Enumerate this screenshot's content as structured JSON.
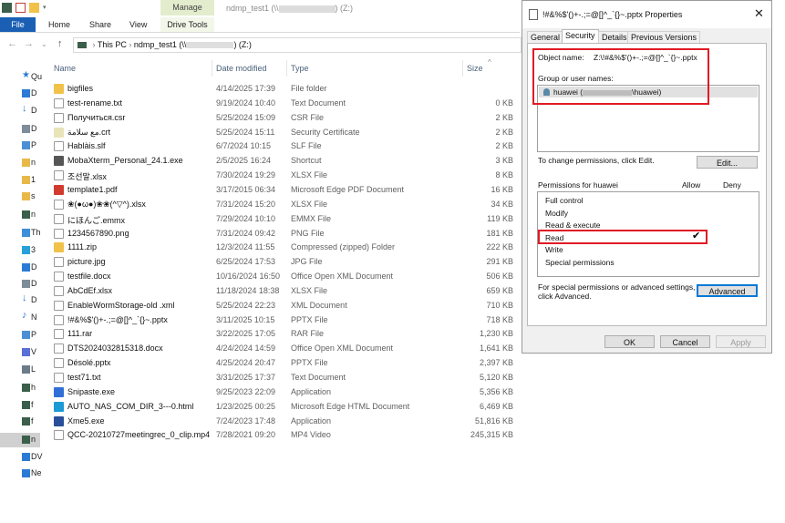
{
  "explorer": {
    "title_tab": "Manage",
    "window_title_prefix": "ndmp_test1 (\\\\",
    "window_title_suffix": ") (Z:)",
    "ribbon": {
      "file": "File",
      "home": "Home",
      "share": "Share",
      "view": "View",
      "drive_tools": "Drive Tools"
    },
    "address": {
      "this_pc": "This PC",
      "share_prefix": "ndmp_test1 (\\\\",
      "share_suffix": ") (Z:)"
    },
    "columns": {
      "name": "Name",
      "date": "Date modified",
      "type": "Type",
      "size": "Size"
    },
    "sidebar": [
      {
        "label": "Qu",
        "icon": "star-icon",
        "color": "#2b7bd6"
      },
      {
        "label": "D",
        "icon": "desktop-icon",
        "color": "#2b7bd6"
      },
      {
        "label": "D",
        "icon": "download-icon",
        "color": "#2b7bd6"
      },
      {
        "label": "D",
        "icon": "document-icon",
        "color": "#7f8c99"
      },
      {
        "label": "P",
        "icon": "pictures-icon",
        "color": "#4d8fd6"
      },
      {
        "label": "n",
        "icon": "folder-icon",
        "color": "#e8b94a"
      },
      {
        "label": "1",
        "icon": "folder-icon",
        "color": "#e8b94a"
      },
      {
        "label": "s",
        "icon": "folder-icon",
        "color": "#e8b94a"
      },
      {
        "label": "n",
        "icon": "network-drive-icon",
        "color": "#3b5f4a"
      },
      {
        "label": "Th",
        "icon": "this-pc-icon",
        "color": "#3c8fd8"
      },
      {
        "label": "3",
        "icon": "3d-objects-icon",
        "color": "#29a0d8"
      },
      {
        "label": "D",
        "icon": "desktop-icon",
        "color": "#2b7bd6"
      },
      {
        "label": "D",
        "icon": "document-icon",
        "color": "#7f8c99"
      },
      {
        "label": "D",
        "icon": "download-icon",
        "color": "#2b7bd6"
      },
      {
        "label": "N",
        "icon": "music-icon",
        "color": "#2b7bd6"
      },
      {
        "label": "P",
        "icon": "pictures-icon",
        "color": "#4d8fd6"
      },
      {
        "label": "V",
        "icon": "videos-icon",
        "color": "#5b6fd6"
      },
      {
        "label": "L",
        "icon": "local-disk-icon",
        "color": "#6b7b8a"
      },
      {
        "label": "h",
        "icon": "network-drive-icon",
        "color": "#3b5f4a"
      },
      {
        "label": "f",
        "icon": "network-drive-icon",
        "color": "#3b5f4a"
      },
      {
        "label": "f",
        "icon": "network-drive-icon",
        "color": "#3b5f4a"
      },
      {
        "label": "n",
        "icon": "network-drive-icon",
        "color": "#3b5f4a"
      },
      {
        "label": "DV",
        "icon": "dvd-drive-icon",
        "color": "#2b7bd6"
      },
      {
        "label": "Ne",
        "icon": "network-icon",
        "color": "#2b7bd6"
      }
    ],
    "files": [
      {
        "name": "bigfiles",
        "date": "4/14/2025 17:39",
        "type": "File folder",
        "size": "",
        "icon": "folder-icon",
        "color": "#f0c24a"
      },
      {
        "name": "test-rename.txt",
        "date": "9/19/2024 10:40",
        "type": "Text Document",
        "size": "0 KB",
        "icon": "text-file-icon",
        "color": "#ffffff"
      },
      {
        "name": "Получиться.csr",
        "date": "5/25/2024 15:09",
        "type": "CSR File",
        "size": "2 KB",
        "icon": "file-icon",
        "color": "#ffffff"
      },
      {
        "name": "مع سلامة.crt",
        "date": "5/25/2024 15:11",
        "type": "Security Certificate",
        "size": "2 KB",
        "icon": "certificate-icon",
        "color": "#e9e3b8"
      },
      {
        "name": "Hablàis.slf",
        "date": "6/7/2024 10:15",
        "type": "SLF File",
        "size": "2 KB",
        "icon": "file-icon",
        "color": "#ffffff"
      },
      {
        "name": "MobaXterm_Personal_24.1.exe",
        "date": "2/5/2025 16:24",
        "type": "Shortcut",
        "size": "3 KB",
        "icon": "shortcut-icon",
        "color": "#555555"
      },
      {
        "name": "조선말.xlsx",
        "date": "7/30/2024 19:29",
        "type": "XLSX File",
        "size": "8 KB",
        "icon": "file-icon",
        "color": "#ffffff"
      },
      {
        "name": "template1.pdf",
        "date": "3/17/2015 06:34",
        "type": "Microsoft Edge PDF Document",
        "size": "16 KB",
        "icon": "pdf-icon",
        "color": "#d13b2e"
      },
      {
        "name": "❀(●ω●)❀❀(^▽^).xlsx",
        "date": "7/31/2024 15:20",
        "type": "XLSX File",
        "size": "34 KB",
        "icon": "file-icon",
        "color": "#ffffff"
      },
      {
        "name": "にほんご.emmx",
        "date": "7/29/2024 10:10",
        "type": "EMMX File",
        "size": "119 KB",
        "icon": "file-icon",
        "color": "#ffffff"
      },
      {
        "name": "1234567890.png",
        "date": "7/31/2024 09:42",
        "type": "PNG File",
        "size": "181 KB",
        "icon": "file-icon",
        "color": "#ffffff"
      },
      {
        "name": "1111.zip",
        "date": "12/3/2024 11:55",
        "type": "Compressed (zipped) Folder",
        "size": "222 KB",
        "icon": "zip-folder-icon",
        "color": "#f0c24a"
      },
      {
        "name": "picture.jpg",
        "date": "6/25/2024 17:53",
        "type": "JPG File",
        "size": "291 KB",
        "icon": "file-icon",
        "color": "#ffffff"
      },
      {
        "name": "testfile.docx",
        "date": "10/16/2024 16:50",
        "type": "Office Open XML Document",
        "size": "506 KB",
        "icon": "file-icon",
        "color": "#ffffff"
      },
      {
        "name": "AbCdEf.xlsx",
        "date": "11/18/2024 18:38",
        "type": "XLSX File",
        "size": "659 KB",
        "icon": "file-icon",
        "color": "#ffffff"
      },
      {
        "name": "EnableWormStorage-old .xml",
        "date": "5/25/2024 22:23",
        "type": "XML Document",
        "size": "710 KB",
        "icon": "file-icon",
        "color": "#ffffff"
      },
      {
        "name": "!#&%$'()+-.;=@[]^_`{}~.pptx",
        "date": "3/11/2025 10:15",
        "type": "PPTX File",
        "size": "718 KB",
        "icon": "file-icon",
        "color": "#ffffff"
      },
      {
        "name": "111.rar",
        "date": "3/22/2025 17:05",
        "type": "RAR File",
        "size": "1,230 KB",
        "icon": "file-icon",
        "color": "#ffffff"
      },
      {
        "name": "DTS2024032815318.docx",
        "date": "4/24/2024 14:59",
        "type": "Office Open XML Document",
        "size": "1,641 KB",
        "icon": "file-icon",
        "color": "#ffffff"
      },
      {
        "name": "Désolé.pptx",
        "date": "4/25/2024 20:47",
        "type": "PPTX File",
        "size": "2,397 KB",
        "icon": "file-icon",
        "color": "#ffffff"
      },
      {
        "name": "test71.txt",
        "date": "3/31/2025 17:37",
        "type": "Text Document",
        "size": "5,120 KB",
        "icon": "text-file-icon",
        "color": "#ffffff"
      },
      {
        "name": "Snipaste.exe",
        "date": "9/25/2023 22:09",
        "type": "Application",
        "size": "5,356 KB",
        "icon": "app-icon",
        "color": "#2f6fd6"
      },
      {
        "name": "AUTO_NAS_COM_DIR_3---0.html",
        "date": "1/23/2025 00:25",
        "type": "Microsoft Edge HTML Document",
        "size": "6,469 KB",
        "icon": "edge-icon",
        "color": "#1b9ad6"
      },
      {
        "name": "Xme5.exe",
        "date": "7/24/2023 17:48",
        "type": "Application",
        "size": "51,816 KB",
        "icon": "app-icon",
        "color": "#2a4f9a"
      },
      {
        "name": "QCC-20210727meetingrec_0_clip.mp4",
        "date": "7/28/2021 09:20",
        "type": "MP4 Video",
        "size": "245,315 KB",
        "icon": "video-file-icon",
        "color": "#ffffff"
      }
    ]
  },
  "dialog": {
    "title": "!#&%$'()+-.;=@[]^_`{}~.pptx Properties",
    "tabs": [
      "General",
      "Security",
      "Details",
      "Previous Versions"
    ],
    "object_name_label": "Object name:",
    "object_name_value": "Z:\\!#&%$'()+-.;=@[]^_`{}~.pptx",
    "group_label": "Group or user names:",
    "group_user_prefix": "huawei (",
    "group_user_suffix": "\\huawei)",
    "change_text": "To change permissions, click Edit.",
    "edit_button": "Edit...",
    "permissions_for": "Permissions for huawei",
    "allow_header": "Allow",
    "deny_header": "Deny",
    "permissions": [
      {
        "label": "Full control",
        "allow": false
      },
      {
        "label": "Modify",
        "allow": false
      },
      {
        "label": "Read & execute",
        "allow": false
      },
      {
        "label": "Read",
        "allow": true
      },
      {
        "label": "Write",
        "allow": false
      },
      {
        "label": "Special permissions",
        "allow": false
      }
    ],
    "special_text_1": "For special permissions or advanced settings,",
    "special_text_2": "click Advanced.",
    "advanced_button": "Advanced",
    "ok_button": "OK",
    "cancel_button": "Cancel",
    "apply_button": "Apply",
    "highlight_color": "#e01b24"
  }
}
